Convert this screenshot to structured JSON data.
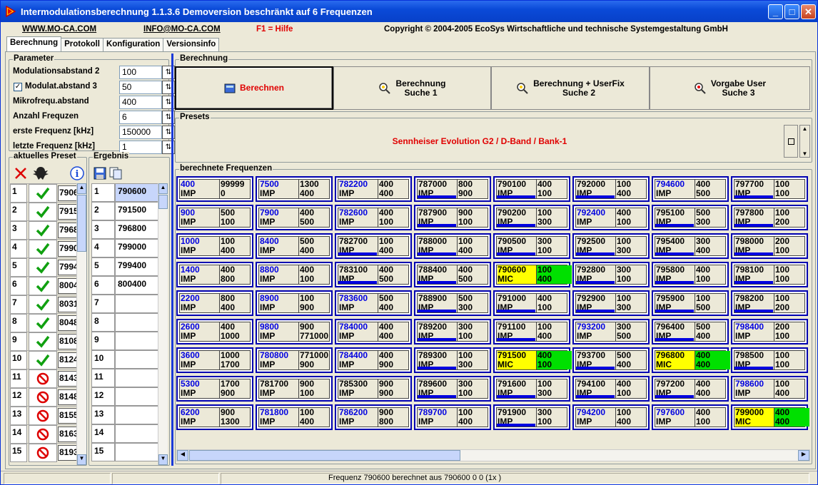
{
  "window": {
    "title": "Intermodulationsberechnung 1.1.3.6 Demoversion beschränkt auf 6 Frequenzen"
  },
  "infobar": {
    "web": "WWW.MO-CA.COM",
    "mail": "INFO@MO-CA.COM",
    "help": "F1 = Hilfe",
    "copyright": "Copyright © 2004-2005 EcoSys Wirtschaftliche und technische Systemgestaltung GmbH"
  },
  "tabs": [
    "Berechnung",
    "Protokoll",
    "Konfiguration",
    "Versionsinfo"
  ],
  "params": {
    "title": "Parameter",
    "rows": [
      {
        "label": "Modulationsabstand 2",
        "value": "100"
      },
      {
        "label": "Modulat.abstand 3",
        "value": "50",
        "checked": true
      },
      {
        "label": "Mikrofrequ.abstand",
        "value": "400"
      },
      {
        "label": "Anzahl Frequzen",
        "value": "6"
      },
      {
        "label": "erste Frequenz [kHz]",
        "value": "150000"
      },
      {
        "label": "letzte Frequenz [kHz]",
        "value": "1"
      }
    ]
  },
  "preset_list": {
    "title": "aktuelles Preset",
    "rows": [
      {
        "n": "1",
        "status": "ok",
        "v": "7906"
      },
      {
        "n": "2",
        "status": "ok",
        "v": "7915"
      },
      {
        "n": "3",
        "status": "ok",
        "v": "7968"
      },
      {
        "n": "4",
        "status": "ok",
        "v": "7990"
      },
      {
        "n": "5",
        "status": "ok",
        "v": "7994"
      },
      {
        "n": "6",
        "status": "ok",
        "v": "8004"
      },
      {
        "n": "7",
        "status": "ok",
        "v": "8031"
      },
      {
        "n": "8",
        "status": "ok",
        "v": "8048"
      },
      {
        "n": "9",
        "status": "ok",
        "v": "8108"
      },
      {
        "n": "10",
        "status": "ok",
        "v": "8124"
      },
      {
        "n": "11",
        "status": "no",
        "v": "8143"
      },
      {
        "n": "12",
        "status": "no",
        "v": "8148"
      },
      {
        "n": "13",
        "status": "no",
        "v": "8155"
      },
      {
        "n": "14",
        "status": "no",
        "v": "8163"
      },
      {
        "n": "15",
        "status": "no",
        "v": "8193"
      }
    ]
  },
  "ergebnis": {
    "title": "Ergebnis",
    "rows": [
      {
        "n": "1",
        "v": "790600"
      },
      {
        "n": "2",
        "v": "791500"
      },
      {
        "n": "3",
        "v": "796800"
      },
      {
        "n": "4",
        "v": "799000"
      },
      {
        "n": "5",
        "v": "799400"
      },
      {
        "n": "6",
        "v": "800400"
      },
      {
        "n": "7",
        "v": ""
      },
      {
        "n": "8",
        "v": ""
      },
      {
        "n": "9",
        "v": ""
      },
      {
        "n": "10",
        "v": ""
      },
      {
        "n": "11",
        "v": ""
      },
      {
        "n": "12",
        "v": ""
      },
      {
        "n": "13",
        "v": ""
      },
      {
        "n": "14",
        "v": ""
      },
      {
        "n": "15",
        "v": ""
      }
    ]
  },
  "berechnung": {
    "title": "Berechnung",
    "buttons": [
      {
        "line1": "Berechnen",
        "line2": ""
      },
      {
        "line1": "Berechnung",
        "line2": "Suche 1"
      },
      {
        "line1": "Berechnung + UserFix",
        "line2": "Suche 2"
      },
      {
        "line1": "Vorgabe User",
        "line2": "Suche 3"
      }
    ]
  },
  "presets": {
    "title": "Presets",
    "value": "Sennheiser Evolution G2 / D-Band / Bank-1"
  },
  "freq": {
    "title": "berechnete Frequenzen",
    "cols": [
      [
        {
          "f": "400",
          "t": "IMP",
          "a": "99999",
          "b": "0",
          "blue": true
        },
        {
          "f": "900",
          "t": "IMP",
          "a": "500",
          "b": "100",
          "blue": true
        },
        {
          "f": "1000",
          "t": "IMP",
          "a": "100",
          "b": "400",
          "blue": true
        },
        {
          "f": "1400",
          "t": "IMP",
          "a": "400",
          "b": "800",
          "blue": true
        },
        {
          "f": "2200",
          "t": "IMP",
          "a": "800",
          "b": "400",
          "blue": true
        },
        {
          "f": "2600",
          "t": "IMP",
          "a": "400",
          "b": "1000",
          "blue": true
        },
        {
          "f": "3600",
          "t": "IMP",
          "a": "1000",
          "b": "1700",
          "blue": true
        },
        {
          "f": "5300",
          "t": "IMP",
          "a": "1700",
          "b": "900",
          "blue": true
        },
        {
          "f": "6200",
          "t": "IMP",
          "a": "900",
          "b": "1300",
          "blue": true
        }
      ],
      [
        {
          "f": "7500",
          "t": "IMP",
          "a": "1300",
          "b": "400",
          "blue": true
        },
        {
          "f": "7900",
          "t": "IMP",
          "a": "400",
          "b": "500",
          "blue": true
        },
        {
          "f": "8400",
          "t": "IMP",
          "a": "500",
          "b": "400",
          "blue": true
        },
        {
          "f": "8800",
          "t": "IMP",
          "a": "400",
          "b": "100",
          "blue": true
        },
        {
          "f": "8900",
          "t": "IMP",
          "a": "100",
          "b": "900",
          "blue": true
        },
        {
          "f": "9800",
          "t": "IMP",
          "a": "900",
          "b": "771000",
          "blue": true
        },
        {
          "f": "780800",
          "t": "IMP",
          "a": "771000",
          "b": "900",
          "blue": true
        },
        {
          "f": "781700",
          "t": "IMP",
          "a": "900",
          "b": "100",
          "blue": false
        },
        {
          "f": "781800",
          "t": "IMP",
          "a": "100",
          "b": "400",
          "blue": true
        }
      ],
      [
        {
          "f": "782200",
          "t": "IMP",
          "a": "400",
          "b": "400",
          "blue": true
        },
        {
          "f": "782600",
          "t": "IMP",
          "a": "400",
          "b": "100",
          "blue": true
        },
        {
          "f": "782700",
          "t": "IMP",
          "a": "100",
          "b": "400",
          "blue": false,
          "bar": true
        },
        {
          "f": "783100",
          "t": "IMP",
          "a": "400",
          "b": "500",
          "blue": false,
          "bar": true
        },
        {
          "f": "783600",
          "t": "IMP",
          "a": "500",
          "b": "400",
          "blue": true
        },
        {
          "f": "784000",
          "t": "IMP",
          "a": "400",
          "b": "400",
          "blue": true
        },
        {
          "f": "784400",
          "t": "IMP",
          "a": "400",
          "b": "900",
          "blue": true
        },
        {
          "f": "785300",
          "t": "IMP",
          "a": "900",
          "b": "900",
          "blue": false
        },
        {
          "f": "786200",
          "t": "IMP",
          "a": "900",
          "b": "800",
          "blue": true
        }
      ],
      [
        {
          "f": "787000",
          "t": "IMP",
          "a": "800",
          "b": "900",
          "blue": false,
          "bar": true
        },
        {
          "f": "787900",
          "t": "IMP",
          "a": "900",
          "b": "100",
          "blue": false,
          "bar": true
        },
        {
          "f": "788000",
          "t": "IMP",
          "a": "100",
          "b": "400",
          "blue": false,
          "bar": true
        },
        {
          "f": "788400",
          "t": "IMP",
          "a": "400",
          "b": "500",
          "blue": false,
          "bar": true
        },
        {
          "f": "788900",
          "t": "IMP",
          "a": "500",
          "b": "300",
          "blue": false,
          "bar": true
        },
        {
          "f": "789200",
          "t": "IMP",
          "a": "300",
          "b": "100",
          "blue": false,
          "bar": true
        },
        {
          "f": "789300",
          "t": "IMP",
          "a": "100",
          "b": "300",
          "blue": false,
          "bar": true
        },
        {
          "f": "789600",
          "t": "IMP",
          "a": "300",
          "b": "100",
          "blue": false,
          "bar": true
        },
        {
          "f": "789700",
          "t": "IMP",
          "a": "100",
          "b": "400",
          "blue": true
        }
      ],
      [
        {
          "f": "790100",
          "t": "IMP",
          "a": "400",
          "b": "100",
          "blue": false,
          "bar": true
        },
        {
          "f": "790200",
          "t": "IMP",
          "a": "100",
          "b": "300",
          "blue": false,
          "bar": true
        },
        {
          "f": "790500",
          "t": "IMP",
          "a": "300",
          "b": "100",
          "blue": false,
          "bar": true
        },
        {
          "f": "790600",
          "t": "MIC",
          "a": "100",
          "b": "400",
          "mic": true
        },
        {
          "f": "791000",
          "t": "IMP",
          "a": "400",
          "b": "100",
          "blue": false,
          "bar": true
        },
        {
          "f": "791100",
          "t": "IMP",
          "a": "100",
          "b": "400",
          "blue": false,
          "bar": true
        },
        {
          "f": "791500",
          "t": "MIC",
          "a": "400",
          "b": "100",
          "mic": true
        },
        {
          "f": "791600",
          "t": "IMP",
          "a": "100",
          "b": "300",
          "blue": false,
          "bar": true
        },
        {
          "f": "791900",
          "t": "IMP",
          "a": "300",
          "b": "100",
          "blue": false,
          "bar": true
        }
      ],
      [
        {
          "f": "792000",
          "t": "IMP",
          "a": "100",
          "b": "400",
          "blue": false,
          "bar": true
        },
        {
          "f": "792400",
          "t": "IMP",
          "a": "400",
          "b": "100",
          "blue": true
        },
        {
          "f": "792500",
          "t": "IMP",
          "a": "100",
          "b": "300",
          "blue": false,
          "bar": true
        },
        {
          "f": "792800",
          "t": "IMP",
          "a": "300",
          "b": "100",
          "blue": false,
          "bar": true
        },
        {
          "f": "792900",
          "t": "IMP",
          "a": "100",
          "b": "300",
          "blue": false,
          "bar": true
        },
        {
          "f": "793200",
          "t": "IMP",
          "a": "300",
          "b": "500",
          "blue": true
        },
        {
          "f": "793700",
          "t": "IMP",
          "a": "500",
          "b": "400",
          "blue": false,
          "bar": true
        },
        {
          "f": "794100",
          "t": "IMP",
          "a": "400",
          "b": "100",
          "blue": false,
          "bar": true
        },
        {
          "f": "794200",
          "t": "IMP",
          "a": "100",
          "b": "400",
          "blue": true
        }
      ],
      [
        {
          "f": "794600",
          "t": "IMP",
          "a": "400",
          "b": "500",
          "blue": true
        },
        {
          "f": "795100",
          "t": "IMP",
          "a": "500",
          "b": "300",
          "blue": false,
          "bar": true
        },
        {
          "f": "795400",
          "t": "IMP",
          "a": "300",
          "b": "400",
          "blue": false,
          "bar": true
        },
        {
          "f": "795800",
          "t": "IMP",
          "a": "400",
          "b": "100",
          "blue": false,
          "bar": true
        },
        {
          "f": "795900",
          "t": "IMP",
          "a": "100",
          "b": "500",
          "blue": false,
          "bar": true
        },
        {
          "f": "796400",
          "t": "IMP",
          "a": "500",
          "b": "400",
          "blue": false,
          "bar": true
        },
        {
          "f": "796800",
          "t": "MIC",
          "a": "400",
          "b": "400",
          "mic": true
        },
        {
          "f": "797200",
          "t": "IMP",
          "a": "400",
          "b": "400",
          "blue": false,
          "bar": true
        },
        {
          "f": "797600",
          "t": "IMP",
          "a": "400",
          "b": "100",
          "blue": true
        }
      ],
      [
        {
          "f": "797700",
          "t": "IMP",
          "a": "100",
          "b": "100",
          "blue": false,
          "bar": true
        },
        {
          "f": "797800",
          "t": "IMP",
          "a": "100",
          "b": "200",
          "blue": false,
          "bar": true
        },
        {
          "f": "798000",
          "t": "IMP",
          "a": "200",
          "b": "100",
          "blue": false,
          "bar": true
        },
        {
          "f": "798100",
          "t": "IMP",
          "a": "100",
          "b": "100",
          "blue": false,
          "bar": true
        },
        {
          "f": "798200",
          "t": "IMP",
          "a": "100",
          "b": "200",
          "blue": false,
          "bar": true
        },
        {
          "f": "798400",
          "t": "IMP",
          "a": "200",
          "b": "100",
          "blue": true
        },
        {
          "f": "798500",
          "t": "IMP",
          "a": "100",
          "b": "100",
          "blue": false,
          "bar": true
        },
        {
          "f": "798600",
          "t": "IMP",
          "a": "100",
          "b": "400",
          "blue": true
        },
        {
          "f": "799000",
          "t": "MIC",
          "a": "400",
          "b": "400",
          "mic": true
        }
      ]
    ]
  },
  "status": {
    "text": "Frequenz 790600 berechnet aus 790600   0   0   (1x )"
  }
}
